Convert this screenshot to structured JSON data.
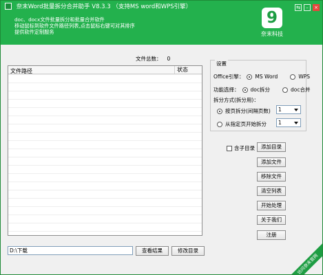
{
  "title": "奈末Word批量拆分合并助手 V8.3.3 （支持MS word和WPS引擎）",
  "description_lines": [
    "doc、docx文件批量拆分和批量合并软件",
    "移动鼠标到软件文件路径列表,点击鼠标右键可对其排序",
    "提供软件定制服务"
  ],
  "logo": {
    "mark": "9",
    "name": "奈末科技"
  },
  "window_controls": {
    "restore": "⇆",
    "minimize": "–",
    "close": "×"
  },
  "file_count": {
    "label": "文件总数：",
    "value": "0"
  },
  "table": {
    "columns": [
      "文件路径",
      "状态"
    ],
    "rows": []
  },
  "output_path": "D:\\下载",
  "buttons": {
    "view_result": "查看结果",
    "modify_dir": "修改目录",
    "add_folder": "添加目录",
    "add_file": "添加文件",
    "remove_file": "移除文件",
    "clear_list": "清空列表",
    "start": "开始处理",
    "about": "关于我们",
    "register": "注册"
  },
  "settings": {
    "title": "设置",
    "office_engine_label": "Office引擎：",
    "office_engine_options": [
      {
        "label": "MS Word",
        "selected": true
      },
      {
        "label": "WPS",
        "selected": false
      }
    ],
    "function_label": "功能选择：",
    "function_options": [
      {
        "label": "doc拆分",
        "selected": true
      },
      {
        "label": "doc合并",
        "selected": false
      }
    ],
    "split_mode_label": "拆分方式(拆分用)：",
    "split_modes": [
      {
        "label": "按页拆分(间隔页数)",
        "selected": true,
        "value": "1"
      },
      {
        "label": "从指定页开始拆分",
        "selected": false,
        "value": "1"
      }
    ]
  },
  "include_subfolder": {
    "label": "含子目录",
    "checked": false
  },
  "corner_link": "访问奈末官网",
  "colors": {
    "header": "#23b14d",
    "accent": "#1e9d43",
    "background": "#f0f0f0"
  }
}
